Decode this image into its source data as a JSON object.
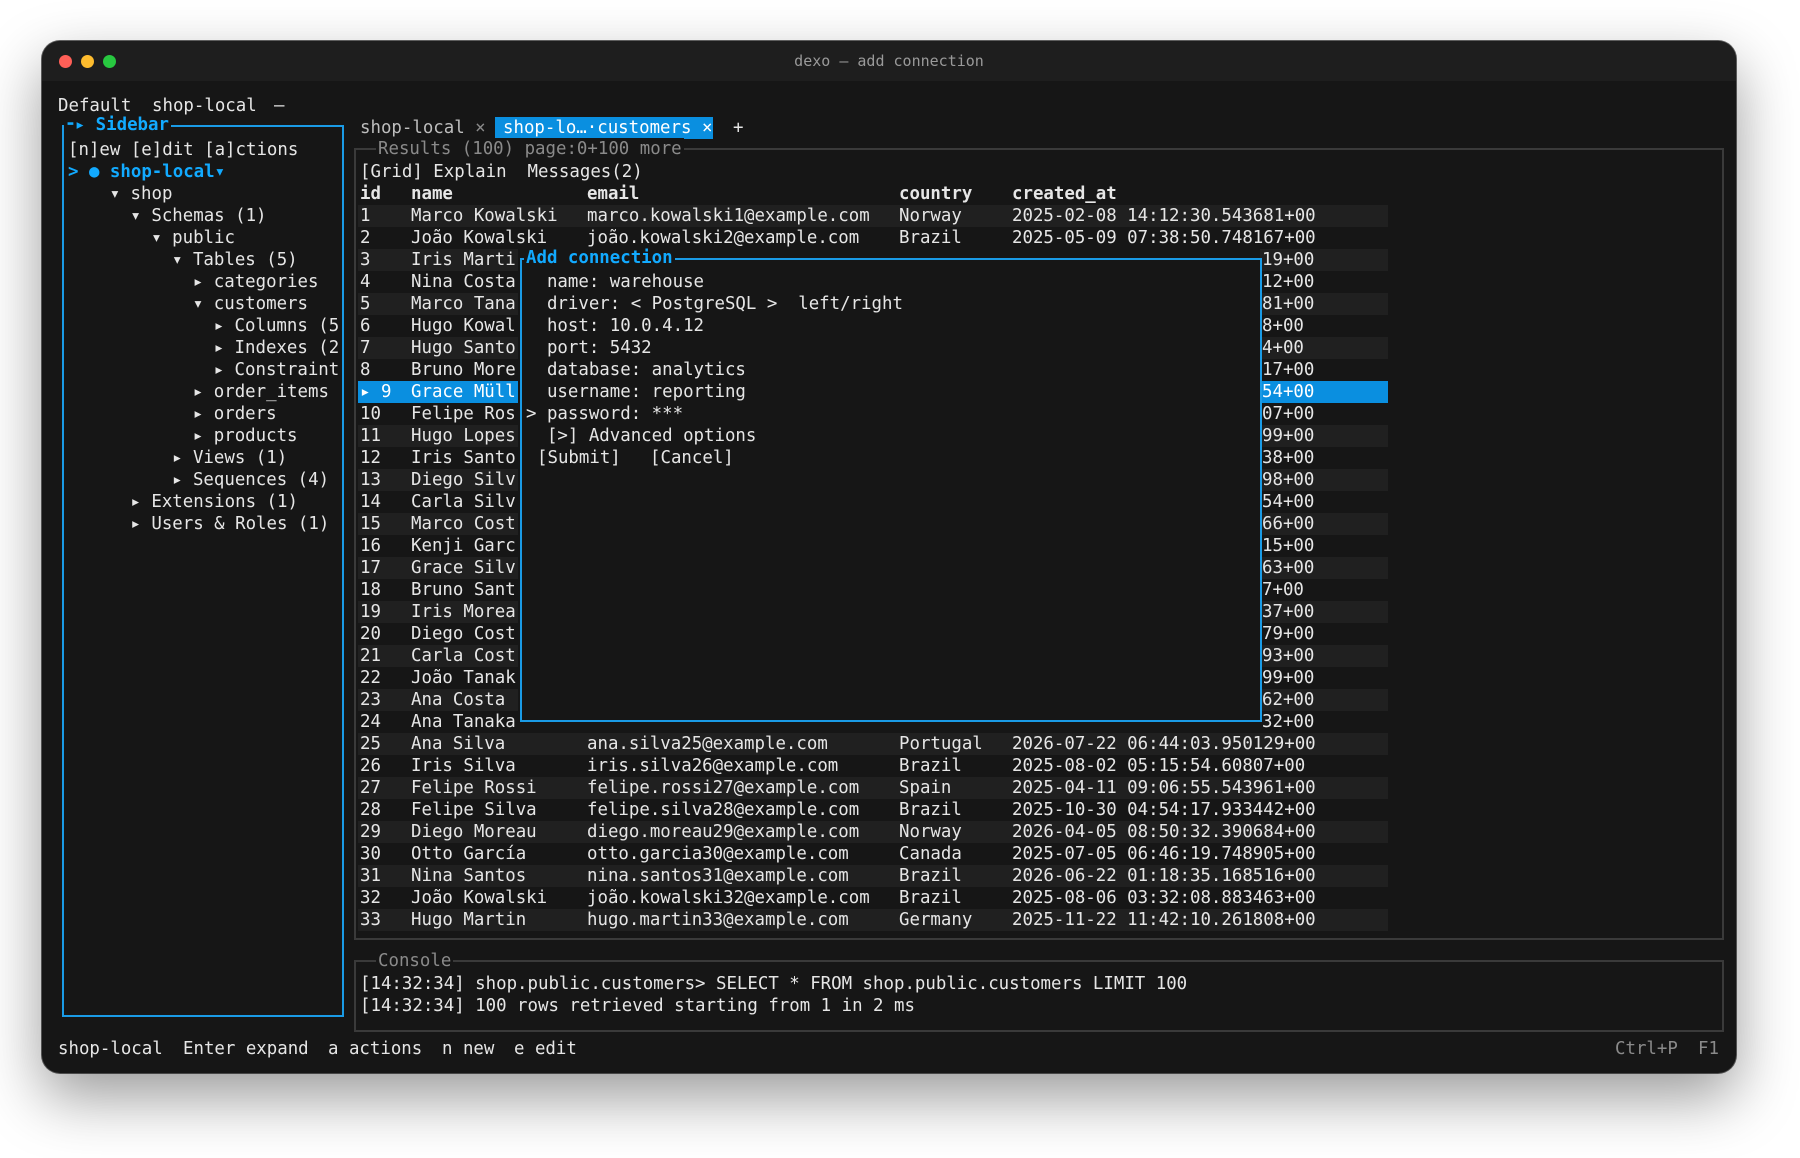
{
  "window": {
    "title": "dexo — add connection"
  },
  "topbar": {
    "profile": "Default",
    "connection": "shop-local",
    "dash": "—"
  },
  "sidebar": {
    "title": "Sidebar",
    "actions": "[n]ew [e]dit [a]ctions",
    "tree": [
      {
        "prefix": ">",
        "dot": "●",
        "label": "shop-local",
        "suffix": "▾",
        "depth": 0,
        "kind": "connection"
      },
      {
        "prefix": "▾",
        "label": "shop",
        "depth": 1
      },
      {
        "prefix": "▾",
        "label": "Schemas (1)",
        "depth": 2
      },
      {
        "prefix": "▾",
        "label": "public",
        "depth": 3
      },
      {
        "prefix": "▾",
        "label": "Tables (5)",
        "depth": 4
      },
      {
        "prefix": "▸",
        "label": "categories",
        "depth": 5
      },
      {
        "prefix": "▾",
        "label": "customers",
        "depth": 5
      },
      {
        "prefix": "▸",
        "label": "Columns (5",
        "depth": 6
      },
      {
        "prefix": "▸",
        "label": "Indexes (2",
        "depth": 6
      },
      {
        "prefix": "▸",
        "label": "Constraint",
        "depth": 6
      },
      {
        "prefix": "▸",
        "label": "order_items",
        "depth": 5
      },
      {
        "prefix": "▸",
        "label": "orders",
        "depth": 5
      },
      {
        "prefix": "▸",
        "label": "products",
        "depth": 5
      },
      {
        "prefix": "▸",
        "label": "Views (1)",
        "depth": 4
      },
      {
        "prefix": "▸",
        "label": "Sequences (4)",
        "depth": 4
      },
      {
        "prefix": "▸",
        "label": "Extensions (1)",
        "depth": 2
      },
      {
        "prefix": "▸",
        "label": "Users & Roles (1)",
        "depth": 2
      }
    ]
  },
  "tabs": {
    "items": [
      {
        "label": "shop-local",
        "close": "×",
        "active": false
      },
      {
        "label": "shop-lo…·customers",
        "close": "×",
        "active": true
      }
    ],
    "add": "+"
  },
  "results": {
    "header": "Results (100) page:0+100 more",
    "subtabs": "[Grid] Explain  Messages(2)",
    "columns": [
      "id",
      "name",
      "email",
      "country",
      "created_at"
    ],
    "rows": [
      [
        "1",
        "Marco Kowalski",
        "marco.kowalski1@example.com",
        "Norway",
        "2025-02-08 14:12:30.543681+00"
      ],
      [
        "2",
        "João Kowalski",
        "joão.kowalski2@example.com",
        "Brazil",
        "2025-05-09 07:38:50.748167+00"
      ],
      [
        "3",
        "Iris Marti",
        "",
        "",
        "19+00"
      ],
      [
        "4",
        "Nina Costa",
        "",
        "",
        "12+00"
      ],
      [
        "5",
        "Marco Tana",
        "",
        "",
        "81+00"
      ],
      [
        "6",
        "Hugo Kowal",
        "",
        "",
        "8+00"
      ],
      [
        "7",
        "Hugo Santo",
        "",
        "",
        "4+00"
      ],
      [
        "8",
        "Bruno More",
        "",
        "",
        "17+00"
      ],
      [
        "9",
        "Grace Müll",
        "",
        "",
        "54+00"
      ],
      [
        "10",
        "Felipe Ros",
        "",
        "",
        "07+00"
      ],
      [
        "11",
        "Hugo Lopes",
        "",
        "",
        "99+00"
      ],
      [
        "12",
        "Iris Santo",
        "",
        "",
        "38+00"
      ],
      [
        "13",
        "Diego Silv",
        "",
        "",
        "98+00"
      ],
      [
        "14",
        "Carla Silv",
        "",
        "",
        "54+00"
      ],
      [
        "15",
        "Marco Cost",
        "",
        "",
        "66+00"
      ],
      [
        "16",
        "Kenji Garc",
        "",
        "",
        "15+00"
      ],
      [
        "17",
        "Grace Silv",
        "",
        "",
        "63+00"
      ],
      [
        "18",
        "Bruno Sant",
        "",
        "",
        "7+00"
      ],
      [
        "19",
        "Iris Morea",
        "",
        "",
        "37+00"
      ],
      [
        "20",
        "Diego Cost",
        "",
        "",
        "79+00"
      ],
      [
        "21",
        "Carla Cost",
        "",
        "",
        "93+00"
      ],
      [
        "22",
        "João Tanak",
        "",
        "",
        "99+00"
      ],
      [
        "23",
        "Ana Costa",
        "",
        "",
        "62+00"
      ],
      [
        "24",
        "Ana Tanaka",
        "",
        "",
        "32+00"
      ],
      [
        "25",
        "Ana Silva",
        "ana.silva25@example.com",
        "Portugal",
        "2026-07-22 06:44:03.950129+00"
      ],
      [
        "26",
        "Iris Silva",
        "iris.silva26@example.com",
        "Brazil",
        "2025-08-02 05:15:54.60807+00"
      ],
      [
        "27",
        "Felipe Rossi",
        "felipe.rossi27@example.com",
        "Spain",
        "2025-04-11 09:06:55.543961+00"
      ],
      [
        "28",
        "Felipe Silva",
        "felipe.silva28@example.com",
        "Brazil",
        "2025-10-30 04:54:17.933442+00"
      ],
      [
        "29",
        "Diego Moreau",
        "diego.moreau29@example.com",
        "Norway",
        "2026-04-05 08:50:32.390684+00"
      ],
      [
        "30",
        "Otto García",
        "otto.garcia30@example.com",
        "Canada",
        "2025-07-05 06:46:19.748905+00"
      ],
      [
        "31",
        "Nina Santos",
        "nina.santos31@example.com",
        "Brazil",
        "2026-06-22 01:18:35.168516+00"
      ],
      [
        "32",
        "João Kowalski",
        "joão.kowalski32@example.com",
        "Brazil",
        "2025-08-06 03:32:08.883463+00"
      ],
      [
        "33",
        "Hugo Martin",
        "hugo.martin33@example.com",
        "Germany",
        "2025-11-22 11:42:10.261808+00"
      ]
    ],
    "selected_row": 9,
    "selection_marker": "▸"
  },
  "modal": {
    "title": "Add connection",
    "fields": [
      {
        "prefix": " ",
        "text": "name: warehouse"
      },
      {
        "prefix": " ",
        "text": "driver: < PostgreSQL >  left/right"
      },
      {
        "prefix": " ",
        "text": "host: 10.0.4.12"
      },
      {
        "prefix": " ",
        "text": "port: 5432"
      },
      {
        "prefix": " ",
        "text": "database: analytics"
      },
      {
        "prefix": " ",
        "text": "username: reporting"
      },
      {
        "prefix": ">",
        "text": "password: ***"
      },
      {
        "prefix": " ",
        "text": "[>] Advanced options"
      }
    ],
    "submit": "[Submit]",
    "cancel": "[Cancel]"
  },
  "console": {
    "title": "Console",
    "lines": [
      "[14:32:34] shop.public.customers> SELECT * FROM shop.public.customers LIMIT 100",
      "[14:32:34] 100 rows retrieved starting from 1 in 2 ms"
    ]
  },
  "statusbar": {
    "left": [
      "shop-local",
      "Enter expand",
      "a actions",
      "n new",
      "e edit"
    ],
    "right": [
      "Ctrl+P",
      "F1"
    ]
  },
  "colors": {
    "accent": "#12aaff",
    "selection": "#0a8fe0",
    "background": "#161616",
    "text": "#e6e6e6"
  }
}
